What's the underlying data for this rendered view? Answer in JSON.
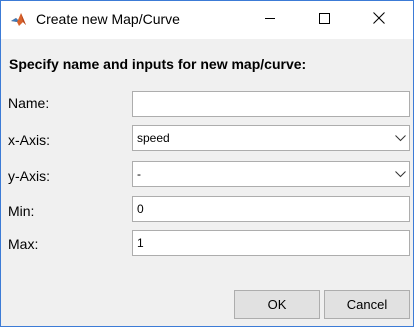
{
  "window": {
    "title": "Create new Map/Curve",
    "accent_color": "#3c7bd6",
    "icons": {
      "app": "matlab-logo-icon",
      "minimize": "minimize-icon",
      "maximize": "maximize-icon",
      "close": "close-icon"
    }
  },
  "form": {
    "heading": "Specify name and inputs for new map/curve:",
    "name": {
      "label": "Name:",
      "value": ""
    },
    "x_axis": {
      "label": "x-Axis:",
      "value": "speed"
    },
    "y_axis": {
      "label": "y-Axis:",
      "value": "-"
    },
    "min": {
      "label": "Min:",
      "value": "0"
    },
    "max": {
      "label": "Max:",
      "value": "1"
    }
  },
  "buttons": {
    "ok": "OK",
    "cancel": "Cancel"
  }
}
